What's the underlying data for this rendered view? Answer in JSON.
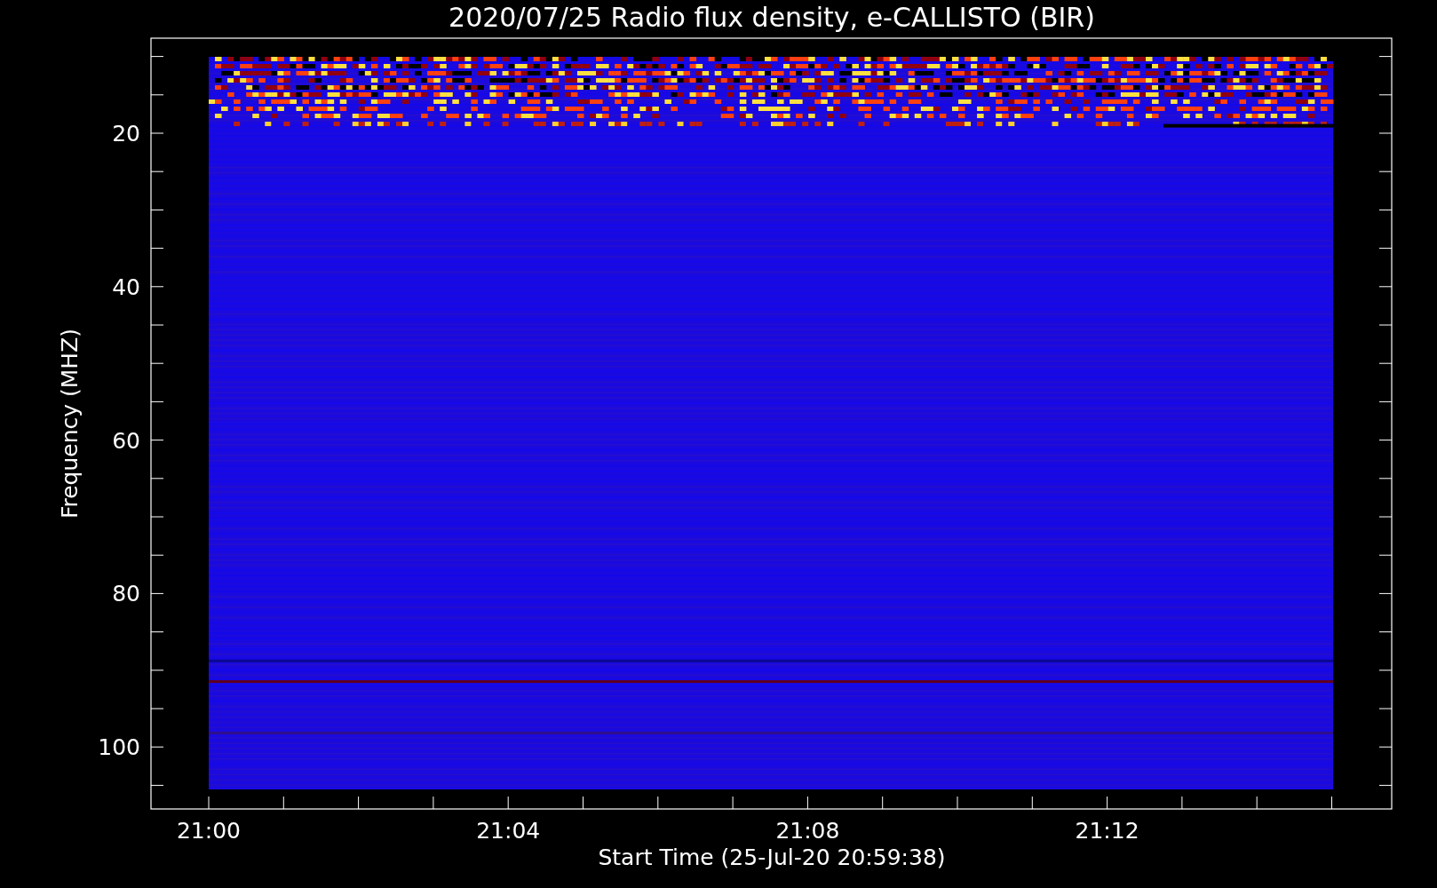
{
  "title": "2020/07/25  Radio flux density, e-CALLISTO (BIR)",
  "y_axis": {
    "label": "Frequency (MHZ)",
    "ticks": [
      "20",
      "40",
      "60",
      "80",
      "100"
    ]
  },
  "x_axis": {
    "label": "Start Time (25-Jul-20 20:59:38)",
    "ticks": [
      "21:00",
      "21:04",
      "21:08",
      "21:12"
    ]
  }
}
